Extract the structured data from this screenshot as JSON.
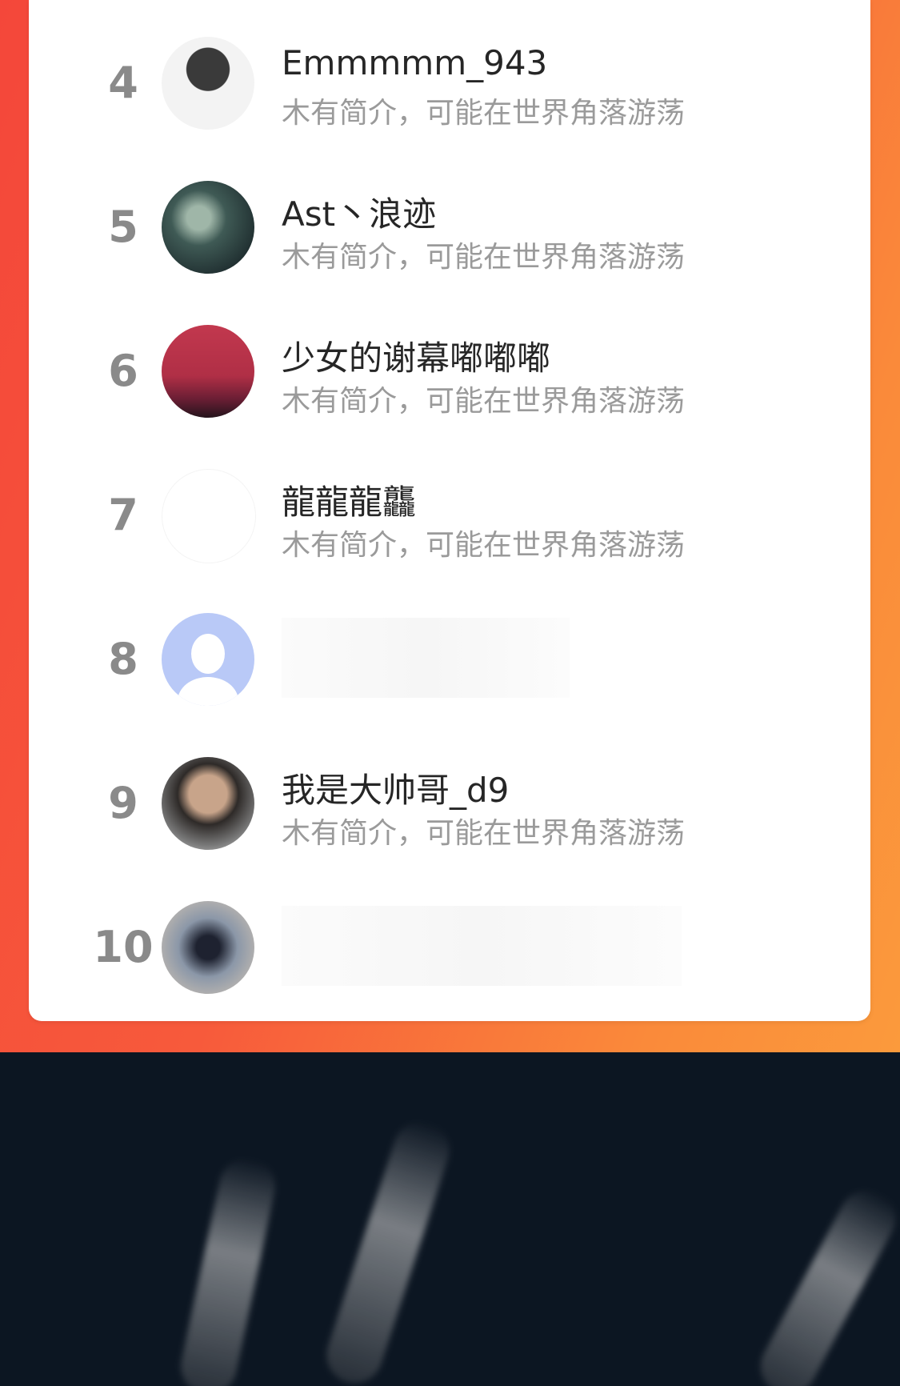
{
  "leaderboard": {
    "entries": [
      {
        "rank": "4",
        "name": "Emmmmm_943",
        "bio": "木有简介，可能在世界角落游荡",
        "avatar_icon": "anime-boy-avatar-icon"
      },
      {
        "rank": "5",
        "name": "Ast丶浪迹",
        "bio": "木有简介，可能在世界角落游荡",
        "avatar_icon": "dark-scene-avatar-icon"
      },
      {
        "rank": "6",
        "name": "少女的谢幕嘟嘟嘟",
        "bio": "木有简介，可能在世界角落游荡",
        "avatar_icon": "red-sky-avatar-icon"
      },
      {
        "rank": "7",
        "name": "龍龍龍龘",
        "bio": "木有简介，可能在世界角落游荡",
        "avatar_icon": "blank-avatar-icon"
      },
      {
        "rank": "8",
        "name": "",
        "bio": "",
        "avatar_icon": "default-person-avatar-icon"
      },
      {
        "rank": "9",
        "name": "我是大帅哥_d9",
        "bio": "木有简介，可能在世界角落游荡",
        "avatar_icon": "man-portrait-avatar-icon"
      },
      {
        "rank": "10",
        "name": "",
        "bio": "",
        "avatar_icon": "figure-photo-avatar-icon"
      }
    ]
  },
  "colors": {
    "gradient_start": "#f4473a",
    "gradient_end": "#fb9a3c",
    "rank_text": "#8a8a8a",
    "name_text": "#262626",
    "bio_text": "#9a9a9a",
    "bottom_background": "#0c1622"
  }
}
